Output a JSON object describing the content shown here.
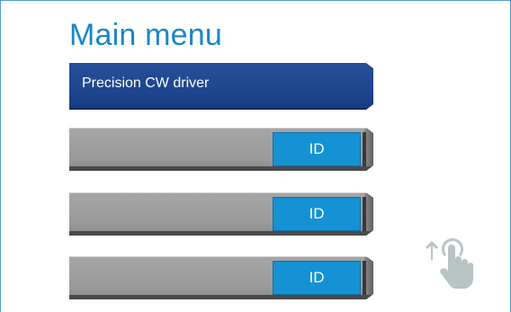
{
  "header": {
    "title": "Main menu"
  },
  "menu": {
    "items": [
      {
        "label": "Precision CW driver",
        "style": "selected"
      },
      {
        "label": "",
        "button_label": "ID"
      },
      {
        "label": "",
        "button_label": "ID"
      },
      {
        "label": "",
        "button_label": "ID"
      }
    ]
  },
  "icons": {
    "scroll_hint": "hand-swipe-up-icon"
  },
  "colors": {
    "accent": "#1a87c8",
    "selected_item": "#1e4690",
    "id_button": "#1492d4",
    "item_bg": "#9a9a9a",
    "hand_icon": "#b8c4c4"
  }
}
